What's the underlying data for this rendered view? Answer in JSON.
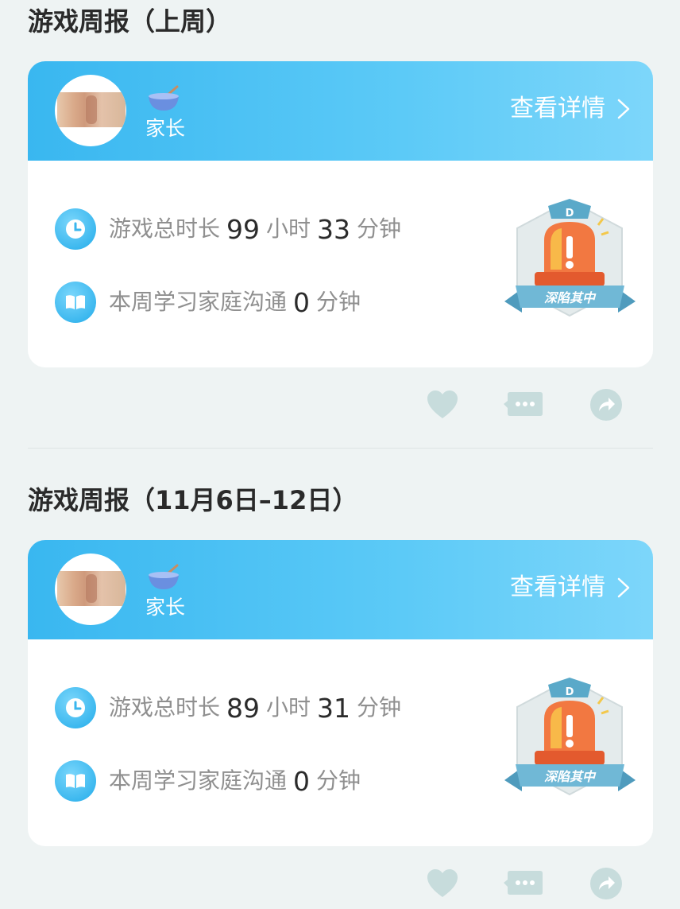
{
  "reports": [
    {
      "title": "游戏周报（上周）",
      "role": "家长",
      "detail_label": "查看详情",
      "play_prefix": "游戏总时长",
      "play_hours": "99",
      "hours_unit": "小时",
      "play_minutes": "33",
      "minutes_unit": "分钟",
      "study_prefix": "本周学习家庭沟通",
      "study_minutes": "0",
      "study_unit": "分钟",
      "badge_letter": "D",
      "badge_text": "深陷其中"
    },
    {
      "title": "游戏周报（11月6日–12日）",
      "role": "家长",
      "detail_label": "查看详情",
      "play_prefix": "游戏总时长",
      "play_hours": "89",
      "hours_unit": "小时",
      "play_minutes": "31",
      "minutes_unit": "分钟",
      "study_prefix": "本周学习家庭沟通",
      "study_minutes": "0",
      "study_unit": "分钟",
      "badge_letter": "D",
      "badge_text": "深陷其中"
    }
  ],
  "icons": {
    "role": "bowl-icon",
    "detail": "chevron-right-icon",
    "play": "clock-icon",
    "study": "book-icon",
    "like": "heart-icon",
    "comment": "comment-icon",
    "share": "share-icon",
    "badge": "alarm-siren-badge"
  },
  "colors": {
    "header_gradient_start": "#39b7f0",
    "header_gradient_end": "#7dd6fa",
    "background": "#eef3f3",
    "action_icon": "#c7dcdc",
    "badge_ribbon": "#6fb7d4",
    "siren": "#f06a3c"
  }
}
